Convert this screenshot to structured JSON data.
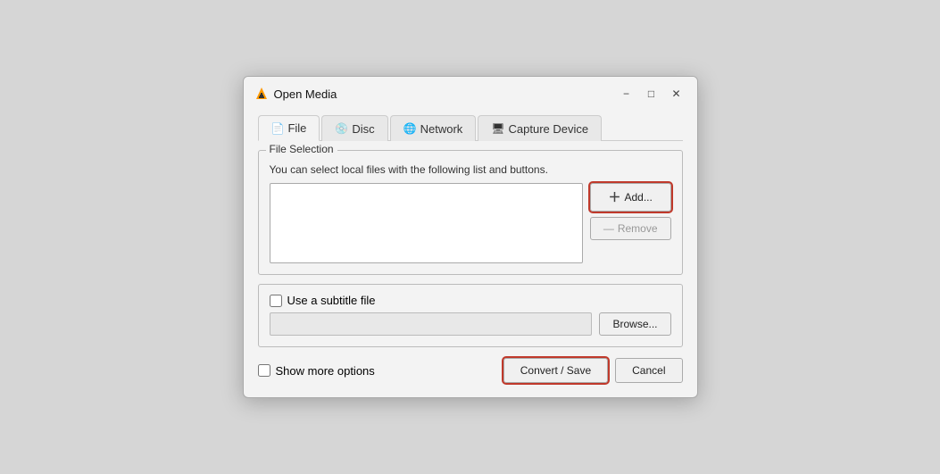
{
  "window": {
    "title": "Open Media",
    "minimize_label": "−",
    "maximize_label": "□",
    "close_label": "✕"
  },
  "tabs": [
    {
      "id": "file",
      "label": "File",
      "icon": "📄",
      "active": true
    },
    {
      "id": "disc",
      "label": "Disc",
      "icon": "💿",
      "active": false
    },
    {
      "id": "network",
      "label": "Network",
      "icon": "🌐",
      "active": false
    },
    {
      "id": "capture",
      "label": "Capture Device",
      "icon": "🖥",
      "active": false
    }
  ],
  "file_selection": {
    "legend": "File Selection",
    "description": "You can select local files with the following list and buttons.",
    "add_label": "+ Add...",
    "remove_label": "— Remove"
  },
  "subtitle": {
    "checkbox_label": "Use a subtitle file",
    "browse_label": "Browse..."
  },
  "bottom": {
    "show_more_label": "Show more options",
    "convert_label": "Convert / Save",
    "cancel_label": "Cancel"
  }
}
